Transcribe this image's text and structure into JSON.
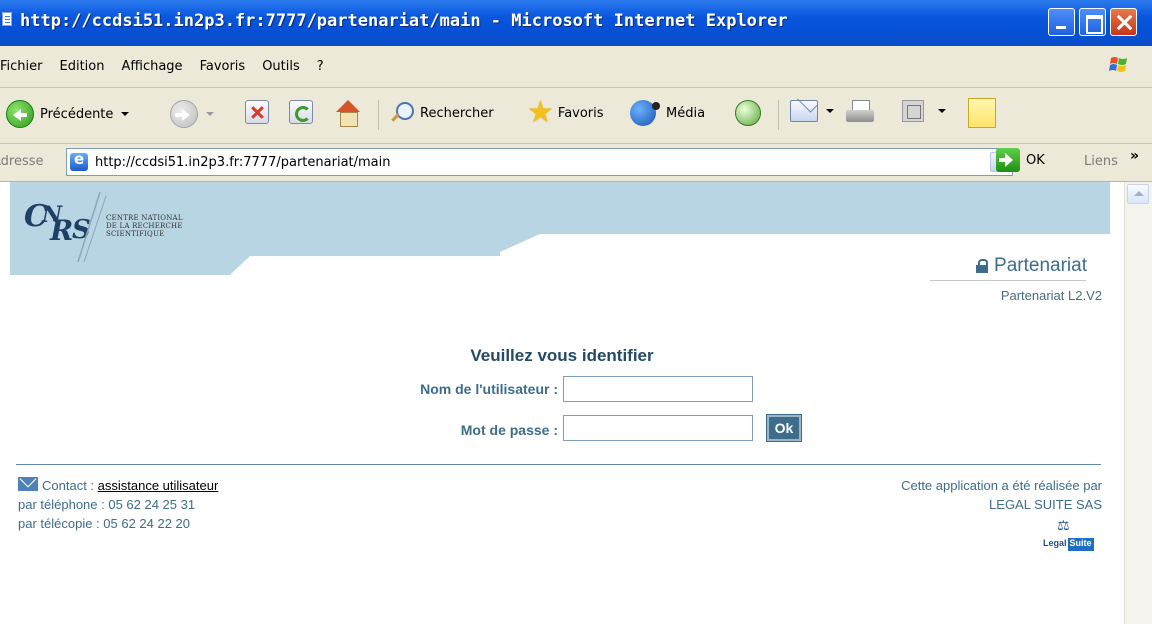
{
  "window": {
    "title": "http://ccdsi51.in2p3.fr:7777/partenariat/main - Microsoft Internet Explorer"
  },
  "menu": [
    "Fichier",
    "Edition",
    "Affichage",
    "Favoris",
    "Outils",
    "?"
  ],
  "toolbar": {
    "back_label": "Précédente",
    "search_label": "Rechercher",
    "favorites_label": "Favoris",
    "media_label": "Média"
  },
  "address": {
    "label": "Adresse",
    "url": "http://ccdsi51.in2p3.fr:7777/partenariat/main",
    "go_label": "OK",
    "links_label": "Liens",
    "more_label": "»"
  },
  "page": {
    "logo_text": "CNRS",
    "org_name_lines": [
      "CENTRE NATIONAL",
      "DE LA RECHERCHE",
      "SCIENTIFIQUE"
    ],
    "app_title": "Partenariat",
    "app_version": "Partenariat L2.V2",
    "login": {
      "heading": "Veuillez vous identifier",
      "username_label": "Nom de l'utilisateur :",
      "username_value": "",
      "password_label": "Mot de passe :",
      "password_value": "",
      "submit_label": "Ok"
    },
    "footer": {
      "contact_prefix": "Contact : ",
      "contact_link": "assistance utilisateur",
      "phone": "par téléphone : 05 62 24 25 31",
      "fax": "par télécopie : 05 62 24 22 20",
      "credit_line1": "Cette application a été réalisée par",
      "credit_line2": "LEGAL SUITE SAS",
      "vendor_logo_a": "Legal",
      "vendor_logo_b": "Suite"
    }
  },
  "colors": {
    "titlebar": "#0a58de",
    "chrome": "#ece9d8",
    "banner": "#b8d5e3",
    "brand_text": "#3e6c8b",
    "heading": "#244a68"
  }
}
